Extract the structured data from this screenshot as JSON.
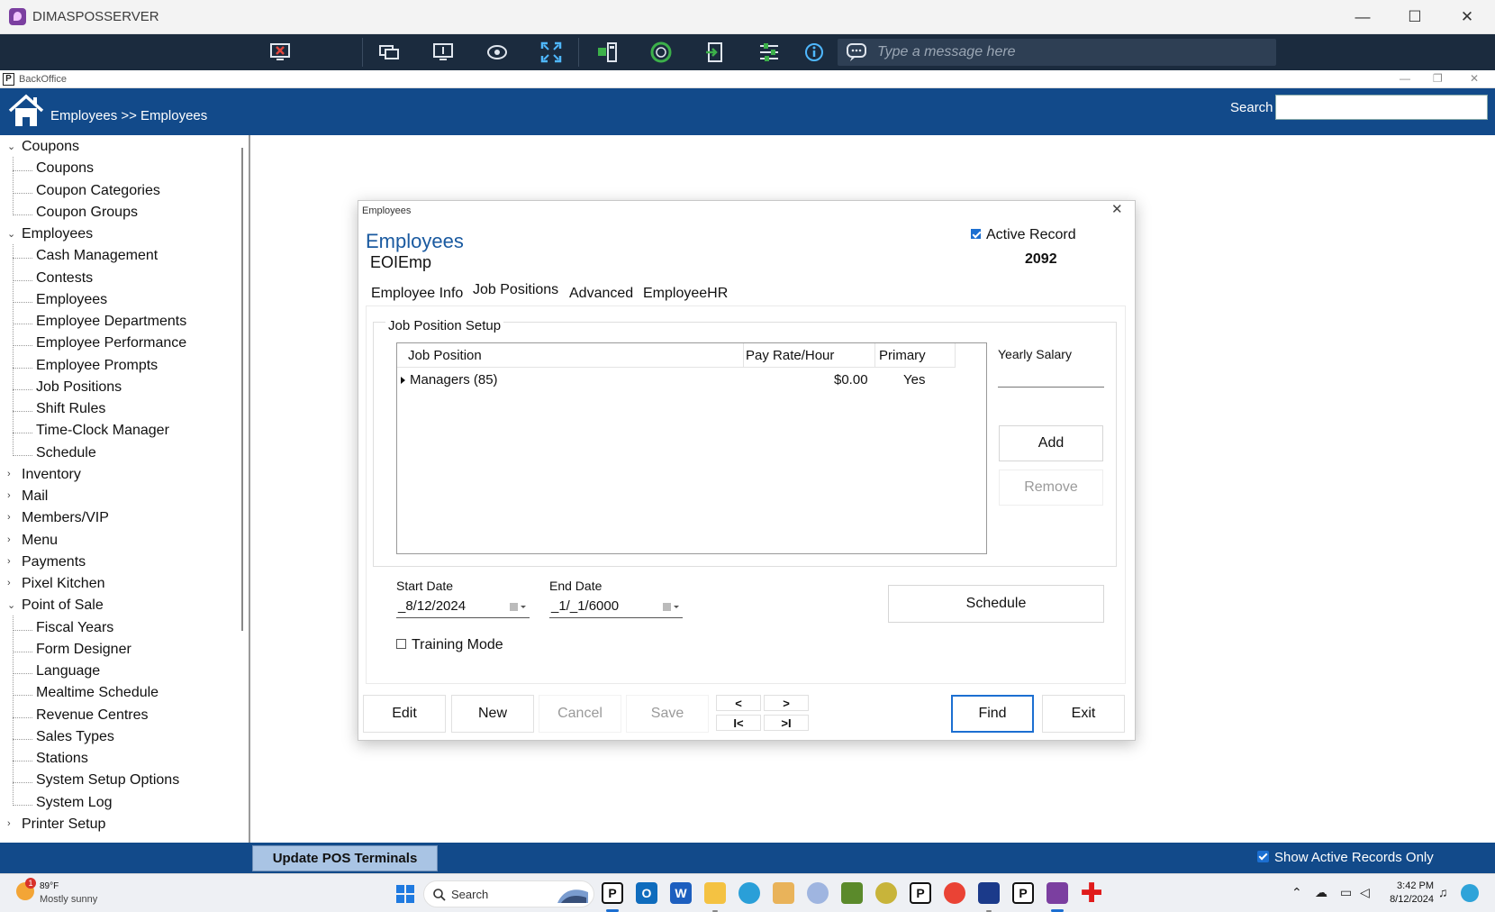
{
  "window": {
    "title": "DIMASPOSSERVER",
    "minimize": "—",
    "maximize": "☐",
    "close": "✕"
  },
  "remote_toolbar": {
    "message_placeholder": "Type a message here"
  },
  "backoffice": {
    "title": "BackOffice",
    "icon_letter": "P",
    "controls": {
      "minimize": "—",
      "restore": "❐",
      "close": "✕"
    },
    "breadcrumb": "Employees >> Employees",
    "search_label": "Search",
    "search_value": ""
  },
  "nav": {
    "toggle_open": "⌄",
    "toggle_closed": "›",
    "groups": [
      {
        "label": "Coupons",
        "expanded": true,
        "children": [
          "Coupons",
          "Coupon Categories",
          "Coupon Groups"
        ]
      },
      {
        "label": "Employees",
        "expanded": true,
        "children": [
          "Cash Management",
          "Contests",
          "Employees",
          "Employee Departments",
          "Employee Performance",
          "Employee Prompts",
          "Job Positions",
          "Shift Rules",
          "Time-Clock Manager",
          "Schedule"
        ]
      },
      {
        "label": "Inventory",
        "expanded": false,
        "children": []
      },
      {
        "label": "Mail",
        "expanded": false,
        "children": []
      },
      {
        "label": "Members/VIP",
        "expanded": false,
        "children": []
      },
      {
        "label": "Menu",
        "expanded": false,
        "children": []
      },
      {
        "label": "Payments",
        "expanded": false,
        "children": []
      },
      {
        "label": "Pixel Kitchen",
        "expanded": false,
        "children": []
      },
      {
        "label": "Point of Sale",
        "expanded": true,
        "children": [
          "Fiscal Years",
          "Form Designer",
          "Language",
          "Mealtime Schedule",
          "Revenue Centres",
          "Sales Types",
          "Stations",
          "System Setup Options",
          "System Log"
        ]
      },
      {
        "label": "Printer Setup",
        "expanded": false,
        "children": []
      }
    ]
  },
  "footer": {
    "update_button": "Update POS Terminals",
    "active_only_label": "Show Active Records Only",
    "active_only_checked": true
  },
  "dialog": {
    "title": "Employees",
    "close": "✕",
    "heading": "Employees",
    "subheading": "EOIEmp",
    "active_record_label": "Active Record",
    "active_record_checked": true,
    "record_id": "2092",
    "tabs": [
      "Employee Info",
      "Job Positions",
      "Advanced",
      "EmployeeHR"
    ],
    "active_tab": "Job Positions",
    "job_setup": {
      "group_label": "Job Position Setup",
      "columns": [
        "Job Position",
        "Pay Rate/Hour",
        "Primary"
      ],
      "rows": [
        {
          "position": "Managers (85)",
          "pay_rate": "$0.00",
          "primary": "Yes"
        }
      ],
      "yearly_salary_label": "Yearly Salary",
      "yearly_salary_value": "",
      "add_button": "Add",
      "remove_button": "Remove"
    },
    "start_date_label": "Start Date",
    "start_date_value": "_8/12/2024",
    "end_date_label": "End Date",
    "end_date_value": "_1/_1/6000",
    "schedule_button": "Schedule",
    "training_mode_label": "Training Mode",
    "training_mode_checked": false,
    "buttons": {
      "edit": "Edit",
      "new": "New",
      "cancel": "Cancel",
      "save": "Save",
      "prev": "<",
      "next": ">",
      "first": "I<",
      "last": ">I",
      "find": "Find",
      "exit": "Exit"
    }
  },
  "taskbar": {
    "weather_temp": "89°F",
    "weather_desc": "Mostly sunny",
    "weather_badge": "1",
    "search_placeholder": "Search",
    "clock_time": "3:42 PM",
    "clock_date": "8/12/2024"
  },
  "colors": {
    "header_blue": "#124a8a",
    "toolbar_dark": "#1b2b3e",
    "accent_blue": "#1c6fd1",
    "heading_blue": "#1a5aa0",
    "update_button_bg": "#a9c4e4"
  }
}
